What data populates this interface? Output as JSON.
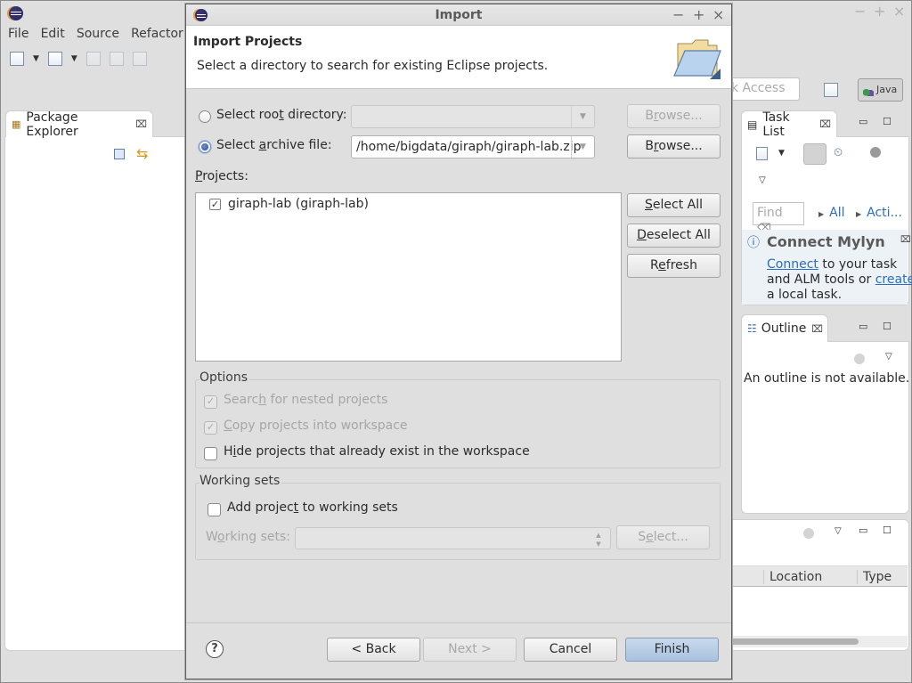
{
  "eclipse": {
    "menu": [
      "File",
      "Edit",
      "Source",
      "Refactor"
    ],
    "window_controls": [
      "−",
      "+",
      "×"
    ],
    "quick_access_placeholder": "k Access",
    "perspective": "Java",
    "package_explorer": {
      "title": "Package Explorer"
    },
    "task_list": {
      "title": "Task List",
      "find_placeholder": "Find",
      "filters": [
        "All",
        "Acti..."
      ],
      "connect_title": "Connect Mylyn",
      "connect_link": "Connect",
      "connect_text_1": " to your task",
      "connect_text_2": "and ALM tools or ",
      "create_link": "create",
      "connect_text_3": "a local task."
    },
    "outline": {
      "title": "Outline",
      "message": "An outline is not available."
    },
    "bottom_panel": {
      "columns": [
        "Location",
        "Type"
      ]
    }
  },
  "dialog": {
    "title": "Import",
    "controls": [
      "−",
      "+",
      "×"
    ],
    "header": {
      "title": "Import Projects",
      "description": "Select a directory to search for existing Eclipse projects."
    },
    "source": {
      "root_directory": {
        "label_pre": "Select roo",
        "mnemonic": "t",
        "label_post": " directory:",
        "selected": false,
        "value": "",
        "browse": {
          "pre": "B",
          "mnemonic": "r",
          "post": "owse..."
        },
        "enabled": false
      },
      "archive_file": {
        "label_pre": "Select ",
        "mnemonic": "a",
        "label_post": "rchive file:",
        "selected": true,
        "value": "/home/bigdata/giraph/giraph-lab.zip",
        "browse": {
          "pre": "B",
          "mnemonic": "r",
          "post": "owse..."
        },
        "enabled": true
      }
    },
    "projects": {
      "label_mnemonic": "P",
      "label_rest": "rojects:",
      "items": [
        {
          "name": "giraph-lab (giraph-lab)",
          "checked": true
        }
      ],
      "buttons": {
        "select_all": {
          "mnemonic": "S",
          "rest": "elect All"
        },
        "deselect_all": {
          "mnemonic": "D",
          "rest": "eselect All"
        },
        "refresh": {
          "pre": "R",
          "mnemonic": "e",
          "post": "fresh"
        }
      }
    },
    "options": {
      "title": "Options",
      "items": [
        {
          "pre": "Searc",
          "mnemonic": "h",
          "post": " for nested projects",
          "checked": true,
          "enabled": false
        },
        {
          "pre": "",
          "mnemonic": "C",
          "post": "opy projects into workspace",
          "checked": true,
          "enabled": false
        },
        {
          "pre": "H",
          "mnemonic": "i",
          "post": "de projects that already exist in the workspace",
          "checked": false,
          "enabled": true
        }
      ]
    },
    "working_sets": {
      "title": "Working sets",
      "add": {
        "pre": "Add projec",
        "mnemonic": "t",
        "post": " to working sets",
        "checked": false
      },
      "label": {
        "pre": "W",
        "mnemonic": "o",
        "post": "rking sets:"
      },
      "value": "",
      "select": {
        "pre": "S",
        "mnemonic": "e",
        "post": "lect..."
      }
    },
    "footer": {
      "help": "?",
      "back": "< Back",
      "next": "Next >",
      "cancel": "Cancel",
      "finish": "Finish"
    }
  }
}
